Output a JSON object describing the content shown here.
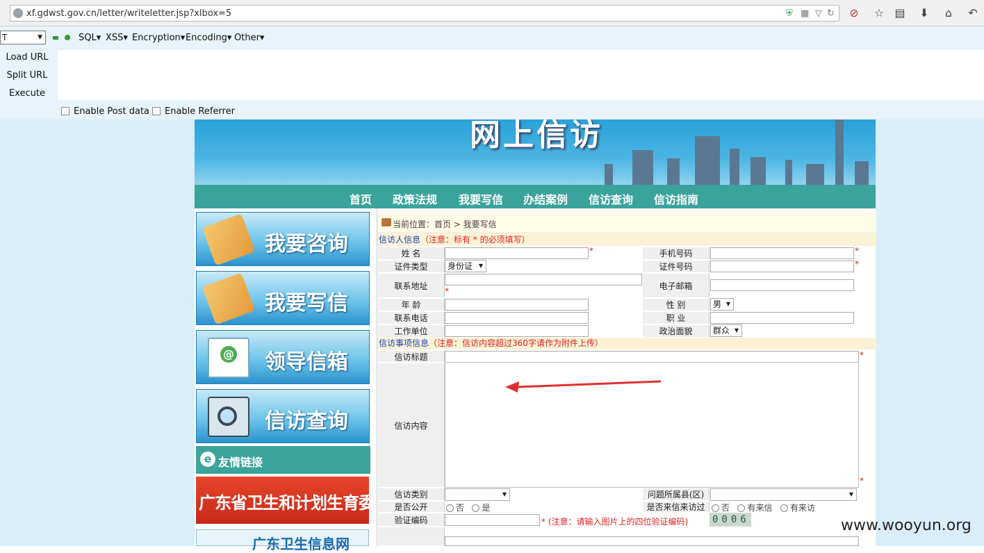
{
  "browser": {
    "url": "xf.gdwst.gov.cn/letter/writeletter.jsp?xlbox=5"
  },
  "hackbar": {
    "select_value": "T",
    "menus": [
      "SQL",
      "XSS",
      "Encryption",
      "Encoding",
      "Other"
    ],
    "buttons": [
      "Load URL",
      "Split URL",
      "Execute"
    ],
    "checks": [
      "Enable Post data",
      "Enable Referrer"
    ]
  },
  "banner": {
    "title": "网上信访"
  },
  "nav": [
    "首页",
    "政策法规",
    "我要写信",
    "办结案例",
    "信访查询",
    "信访指南"
  ],
  "sidebar": {
    "cards": [
      "我要咨询",
      "我要写信",
      "领导信箱",
      "信访查询"
    ],
    "friend_links_title": "友情链接",
    "ad1": "广东省卫生和计划生育委员会",
    "ad2": "广东卫生信息网"
  },
  "breadcrumb": "当前位置：首页 > 我要写信",
  "form": {
    "section1_title": "信访人信息",
    "section1_note": "（注意：标有 * 的必须填写）",
    "section2_title": "信访事项信息",
    "section2_note": "（注意：信访内容超过360字请作为附件上传）",
    "labels": {
      "name": "姓 名",
      "mobile": "手机号码",
      "id_type": "证件类型",
      "id_number": "证件号码",
      "address": "联系地址",
      "email": "电子邮箱",
      "age": "年 龄",
      "gender": "性 别",
      "phone": "联系电话",
      "occupation": "职 业",
      "workplace": "工作单位",
      "politics": "政治面貌",
      "subject": "信访标题",
      "content": "信访内容",
      "category": "信访类别",
      "district": "问题所属县(区)",
      "public": "是否公开",
      "visited": "是否来信来访过",
      "captcha": "验证编码"
    },
    "id_type_value": "身份证",
    "gender_value": "男",
    "politics_value": "群众",
    "public_options": [
      "否",
      "是"
    ],
    "visited_options": [
      "否",
      "有来信",
      "有来访"
    ],
    "captcha_note": "* (注意：请输入图片上的四位验证编码)",
    "captcha_code": "0006",
    "required_mark": "*"
  },
  "watermark": "www.wooyun.org"
}
